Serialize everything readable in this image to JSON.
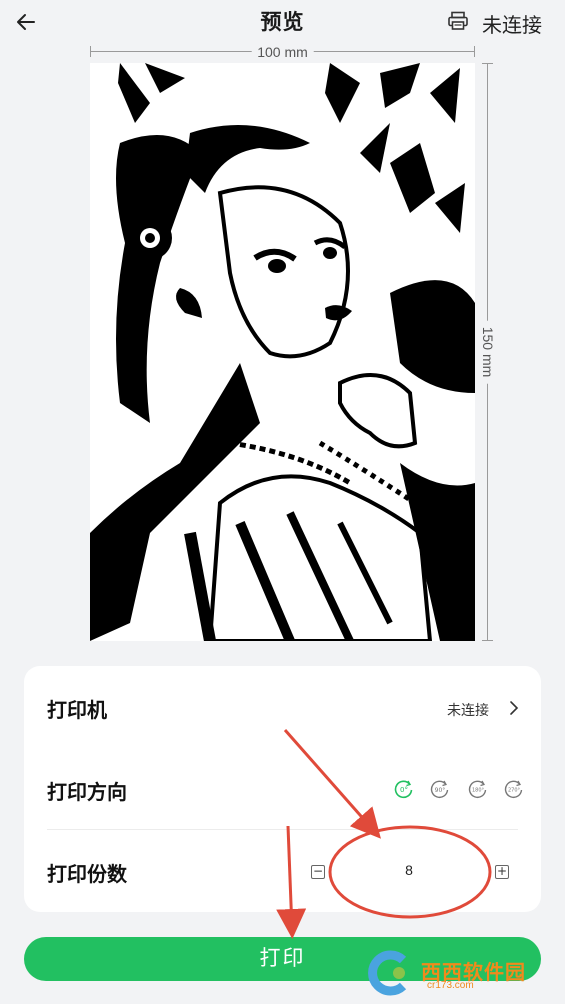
{
  "header": {
    "title": "预览",
    "status": "未连接",
    "icons": {
      "back": "back-arrow-icon",
      "printer": "printer-icon"
    }
  },
  "preview": {
    "width_label": "100 mm",
    "height_label": "150 mm",
    "image": "black-and-white illustration of a girl"
  },
  "settings": {
    "printer": {
      "label": "打印机",
      "value": "未连接"
    },
    "orientation": {
      "label": "打印方向",
      "options": [
        "0°",
        "90°",
        "180°",
        "270°"
      ],
      "selected": "0°"
    },
    "copies": {
      "label": "打印份数",
      "value": "8",
      "minus": "−",
      "plus": "+"
    }
  },
  "print_button": {
    "label": "打印"
  },
  "colors": {
    "accent": "#22c061",
    "background": "#f2f3f5",
    "annotation": "#e04a3a",
    "watermark": "#f08a1c"
  },
  "watermark": {
    "text": "西西软件园",
    "sub": "cr173.com"
  }
}
